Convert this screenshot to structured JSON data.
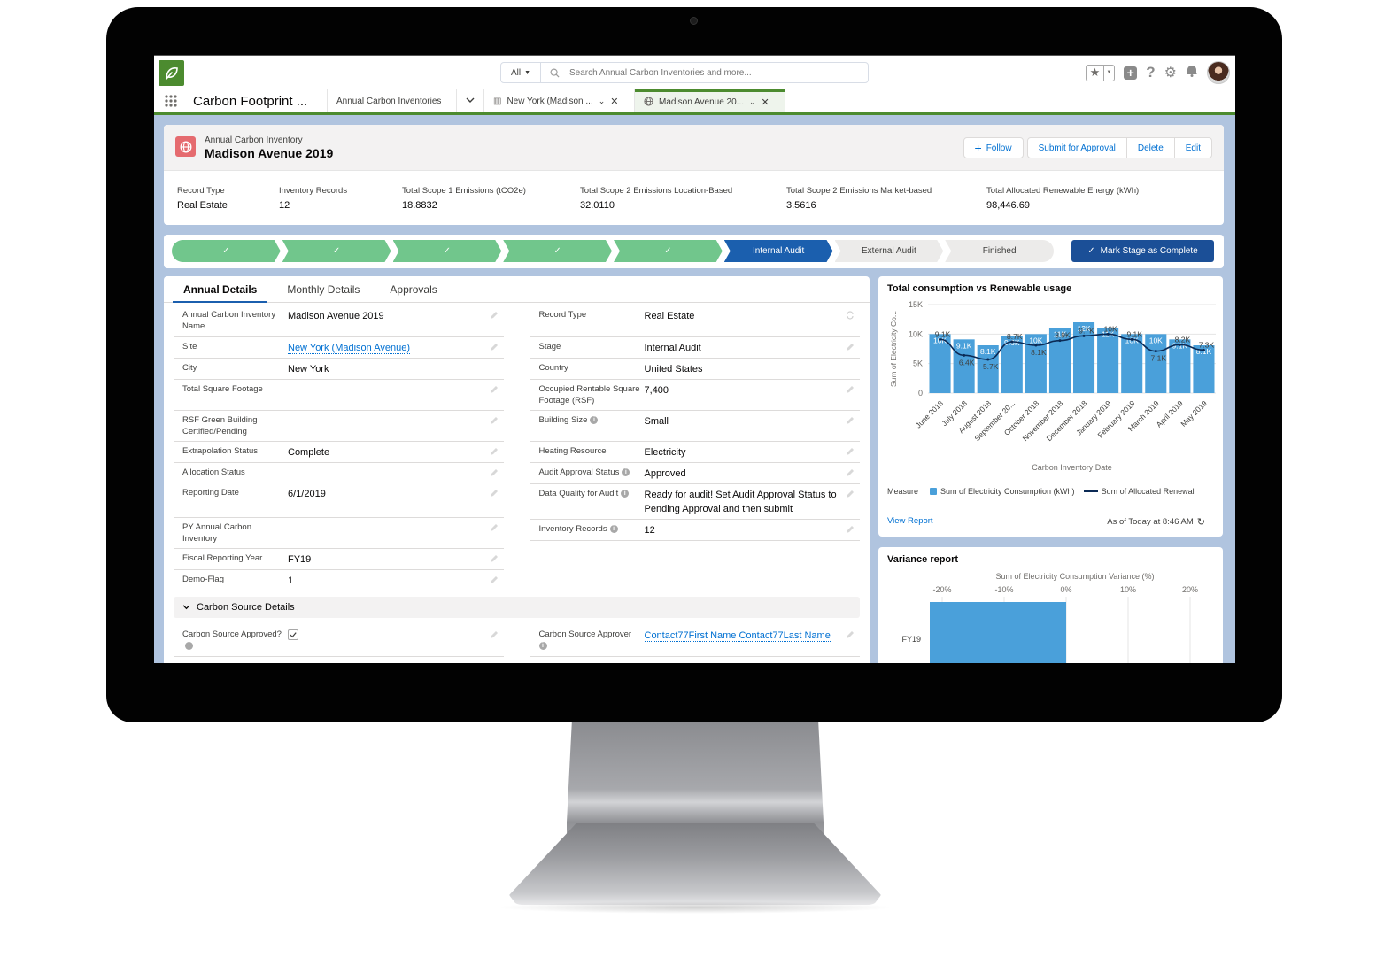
{
  "header": {
    "search_scope": "All",
    "search_placeholder": "Search Annual Carbon Inventories and more..."
  },
  "nav": {
    "app_name": "Carbon Footprint ...",
    "tabs": [
      {
        "label": "Annual Carbon Inventories"
      },
      {
        "label": "New York (Madison ..."
      },
      {
        "label": "Madison Avenue 20..."
      }
    ]
  },
  "record": {
    "object_label": "Annual Carbon Inventory",
    "title": "Madison Avenue 2019",
    "actions": {
      "follow": "Follow",
      "submit": "Submit for Approval",
      "delete": "Delete",
      "edit": "Edit"
    },
    "highlights": [
      {
        "label": "Record Type",
        "value": "Real Estate"
      },
      {
        "label": "Inventory Records",
        "value": "12"
      },
      {
        "label": "Total Scope 1 Emissions (tCO2e)",
        "value": "18.8832"
      },
      {
        "label": "Total Scope 2 Emissions Location-Based",
        "value": "32.0110"
      },
      {
        "label": "Total Scope 2 Emissions Market-based",
        "value": "3.5616"
      },
      {
        "label": "Total Allocated Renewable Energy (kWh)",
        "value": "98,446.69"
      }
    ]
  },
  "path": {
    "stages": [
      {
        "label": "",
        "status": "complete"
      },
      {
        "label": "",
        "status": "complete"
      },
      {
        "label": "",
        "status": "complete"
      },
      {
        "label": "",
        "status": "complete"
      },
      {
        "label": "",
        "status": "complete"
      },
      {
        "label": "Internal Audit",
        "status": "current"
      },
      {
        "label": "External Audit",
        "status": "incomplete"
      },
      {
        "label": "Finished",
        "status": "incomplete"
      }
    ],
    "mark_complete": "Mark Stage as Complete"
  },
  "details": {
    "tabs": [
      "Annual Details",
      "Monthly Details",
      "Approvals"
    ],
    "left": [
      {
        "label": "Annual Carbon Inventory Name",
        "value": "Madison Avenue 2019"
      },
      {
        "label": "Site",
        "value": "New York (Madison Avenue)"
      },
      {
        "label": "City",
        "value": "New York"
      },
      {
        "label": "Total Square Footage",
        "value": ""
      },
      {
        "label": "RSF Green Building Certified/Pending",
        "value": ""
      },
      {
        "label": "Extrapolation Status",
        "value": "Complete"
      },
      {
        "label": "Allocation Status",
        "value": ""
      },
      {
        "label": "Reporting Date",
        "value": "6/1/2019"
      },
      {
        "label": "PY Annual Carbon Inventory",
        "value": ""
      },
      {
        "label": "Fiscal Reporting Year",
        "value": "FY19"
      },
      {
        "label": "Demo-Flag",
        "value": "1"
      }
    ],
    "right": [
      {
        "label": "Record Type",
        "value": "Real Estate"
      },
      {
        "label": "Stage",
        "value": "Internal Audit"
      },
      {
        "label": "Country",
        "value": "United States"
      },
      {
        "label": "Occupied Rentable Square Footage (RSF)",
        "value": "7,400"
      },
      {
        "label": "Building Size",
        "value": "Small"
      },
      {
        "label": "Heating Resource",
        "value": "Electricity"
      },
      {
        "label": "Audit Approval Status",
        "value": "Approved"
      },
      {
        "label": "Data Quality for Audit",
        "value": "Ready for audit! Set Audit Approval Status to Pending Approval and then submit"
      },
      {
        "label": "Inventory Records",
        "value": "12"
      }
    ],
    "section": "Carbon Source Details",
    "section_left": {
      "label": "Carbon Source Approved?",
      "checked": true
    },
    "section_right": {
      "label": "Carbon Source Approver",
      "value": "Contact77First Name Contact77Last Name"
    }
  },
  "chart_card": {
    "title": "Total consumption vs Renewable usage",
    "legend_label": "Measure",
    "view_report": "View Report",
    "as_of": "As of Today at 8:46 AM"
  },
  "variance_card": {
    "title": "Variance report"
  },
  "chart_data": [
    {
      "type": "bar",
      "title": "Total consumption vs Renewable usage",
      "xlabel": "Carbon Inventory Date",
      "ylabel": "Sum of Electricity Co...",
      "ylim": [
        0,
        15000
      ],
      "yticks": [
        "0",
        "5K",
        "10K",
        "15K"
      ],
      "grid": true,
      "categories": [
        "June 2018",
        "July 2018",
        "August 2018",
        "September 20...",
        "October 2018",
        "November 2018",
        "December 2018",
        "January 2019",
        "February 2019",
        "March 2019",
        "April 2019",
        "May 2019"
      ],
      "series": [
        {
          "name": "Sum of Electricity Consumption (kWh)",
          "type": "bar",
          "color": "#4aa0da",
          "values": [
            10000,
            9100,
            8100,
            9600,
            10000,
            11000,
            12000,
            11000,
            10000,
            10000,
            9100,
            8100
          ],
          "labels": [
            "10K",
            "9.1K",
            "8.1K",
            "9.6K",
            "10K",
            "11K",
            "12K",
            "11K",
            "10K",
            "10K",
            "9.1K",
            "8.1K"
          ]
        },
        {
          "name": "Sum of Allocated Renewal",
          "type": "line",
          "color": "#0b2a55",
          "values": [
            9100,
            6400,
            5700,
            8700,
            8100,
            8900,
            9700,
            10000,
            9100,
            7100,
            8200,
            7300
          ],
          "labels": [
            "9.1K",
            "6.4K",
            "5.7K",
            "8.7K",
            "8.1K",
            "8.9K",
            "9.7K",
            "10K",
            "9.1K",
            "7.1K",
            "8.2K",
            "7.3K"
          ]
        }
      ],
      "legend": "bottom"
    },
    {
      "type": "bar",
      "orientation": "horizontal",
      "title": "Sum of Electricity Consumption Variance (%)",
      "categories": [
        "FY19"
      ],
      "values": [
        -22
      ],
      "xlim": [
        -22,
        22
      ],
      "xticks": [
        "-20%",
        "-10%",
        "0%",
        "10%",
        "20%"
      ],
      "color": "#4aa0da"
    }
  ]
}
